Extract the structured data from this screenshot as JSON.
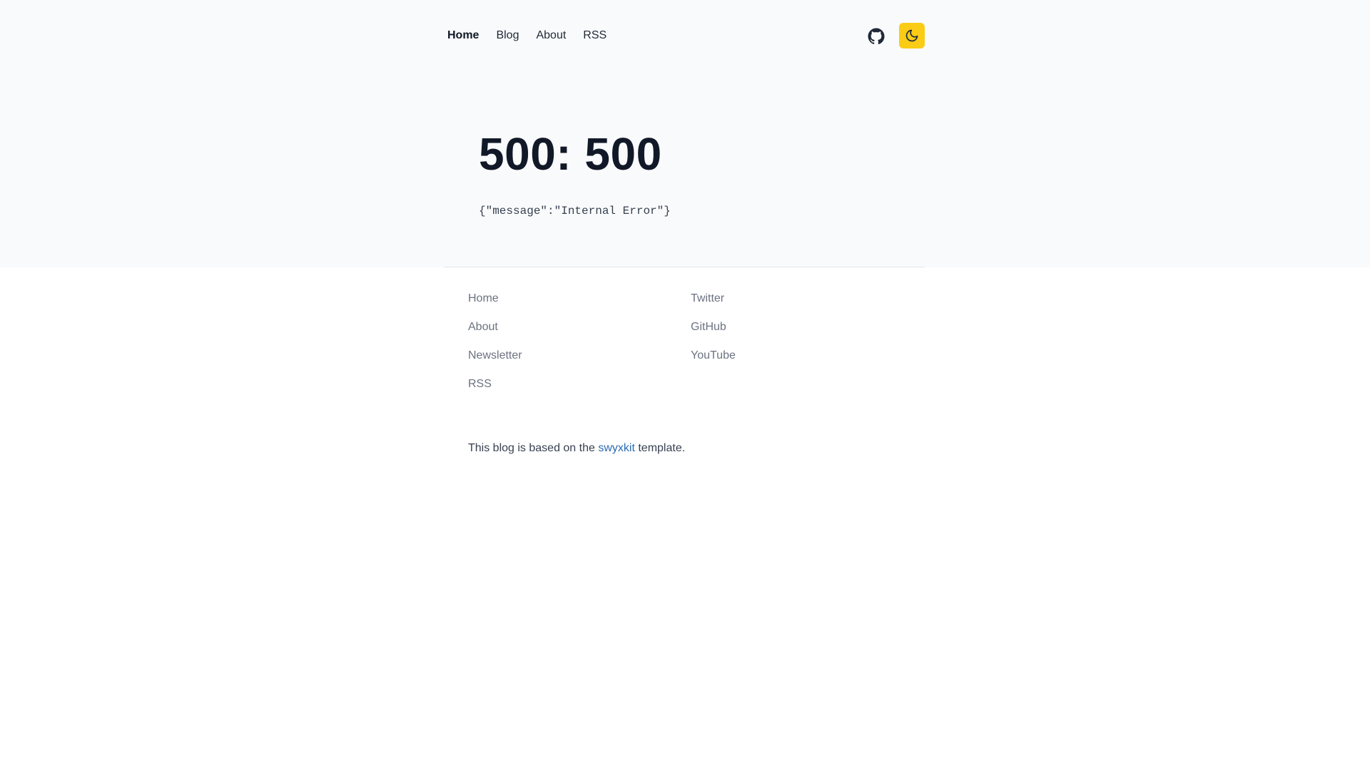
{
  "nav": {
    "links": [
      "Home",
      "Blog",
      "About",
      "RSS"
    ],
    "active": "Home"
  },
  "header_icons": {
    "github": "github-icon",
    "theme_toggle": "moon-icon",
    "theme_toggle_bg": "#facc15"
  },
  "error": {
    "title": "500: 500",
    "message": "{\"message\":\"Internal Error\"}"
  },
  "footer": {
    "left_links": [
      "Home",
      "About",
      "Newsletter",
      "RSS"
    ],
    "right_links": [
      "Twitter",
      "GitHub",
      "YouTube"
    ],
    "credit_prefix": "This blog is based on the ",
    "credit_link": "swyxkit",
    "credit_suffix": " template.",
    "link_color": "#2b6cb0"
  }
}
